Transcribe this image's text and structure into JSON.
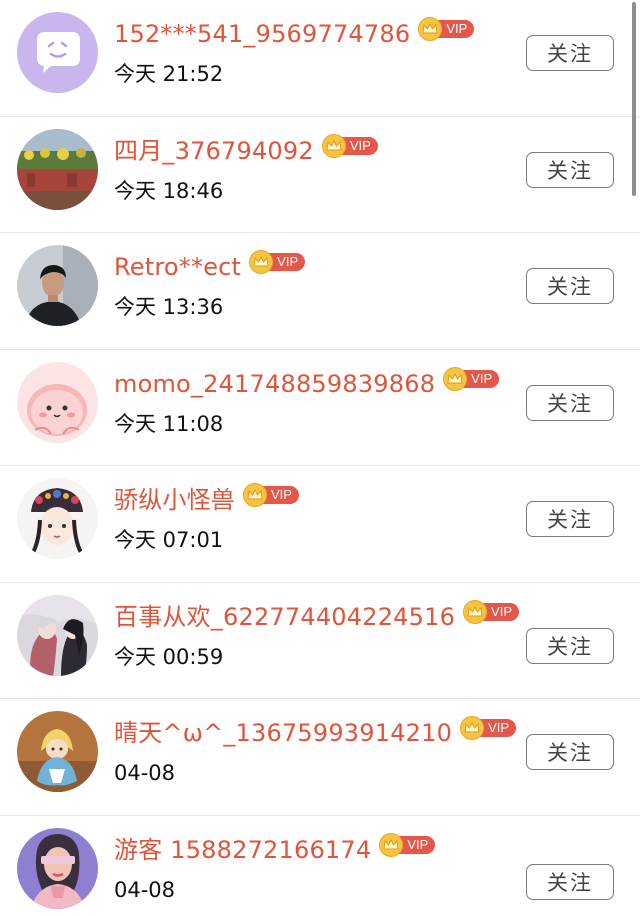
{
  "follow_label": "关注",
  "vip_label": "VIP",
  "users": [
    {
      "name": "152***541_9569774786",
      "time": "今天 21:52",
      "avatar": "purple-chat-icon"
    },
    {
      "name": "四月_376794092",
      "time": "今天 18:46",
      "avatar": "garden-photo"
    },
    {
      "name": "Retro**ect",
      "time": "今天 13:36",
      "avatar": "man-photo"
    },
    {
      "name": "momo_241748859839868",
      "time": "今天 11:08",
      "avatar": "pink-cartoon"
    },
    {
      "name": "骄纵小怪兽",
      "time": "今天 07:01",
      "avatar": "queen-cartoon"
    },
    {
      "name": "百事从欢_622774404224516",
      "time": "今天 00:59",
      "avatar": "anime-couple"
    },
    {
      "name": "晴天^ω^_13675993914210",
      "time": "04-08",
      "avatar": "alice-illustration"
    },
    {
      "name": "游客 1588272166174",
      "time": "04-08",
      "avatar": "blindfold-illustration"
    }
  ],
  "colors": {
    "name": "#e0553a",
    "vip_badge": "#e4574a",
    "crown": "#f5c542",
    "button_border": "#7a7a7a"
  }
}
